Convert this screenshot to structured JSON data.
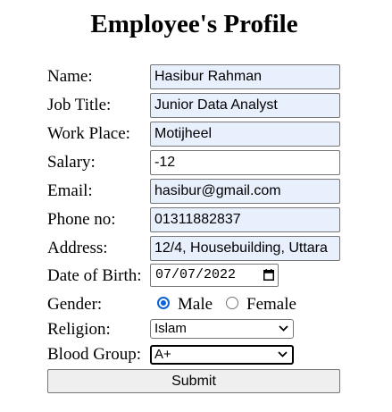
{
  "page": {
    "title": "Employee's Profile"
  },
  "form": {
    "labels": {
      "name": "Name:",
      "job_title": "Job Title:",
      "work_place": "Work Place:",
      "salary": "Salary:",
      "email": "Email:",
      "phone": "Phone no:",
      "address": "Address:",
      "dob": "Date of Birth:",
      "gender": "Gender:",
      "religion": "Religion:",
      "blood_group": "Blood Group:"
    },
    "values": {
      "name": "Hasibur Rahman",
      "job_title": "Junior Data Analyst",
      "work_place": "Motijheel",
      "salary": "-12",
      "email": "hasibur@gmail.com",
      "phone": "01311882837",
      "address": "12/4, Housebuilding, Uttara",
      "dob": "07/07/2022",
      "religion": "Islam",
      "blood_group": "A+"
    },
    "gender_options": {
      "male": "Male",
      "female": "Female",
      "selected": "male"
    },
    "submit_label": "Submit"
  },
  "icons": {
    "date_picker": "calendar-icon",
    "select_arrow": "chevron-down-icon"
  },
  "colors": {
    "autofill_background": "#e8f0fe",
    "radio_checked": "#0b62d8",
    "button_background": "#efefef",
    "field_border": "#767676"
  }
}
